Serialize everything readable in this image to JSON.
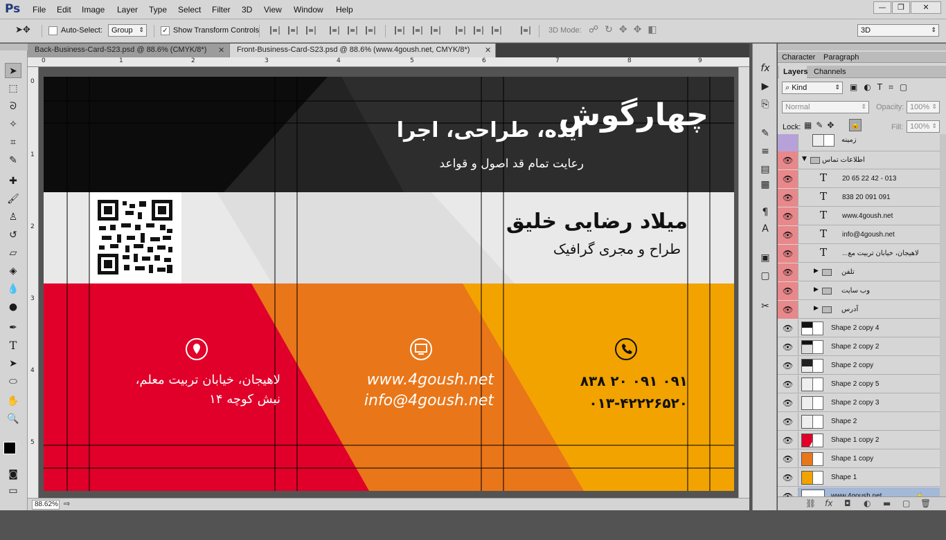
{
  "app": {
    "logo": "Ps"
  },
  "menu": [
    "File",
    "Edit",
    "Image",
    "Layer",
    "Type",
    "Select",
    "Filter",
    "3D",
    "View",
    "Window",
    "Help"
  ],
  "window_controls": {
    "minimize": "—",
    "restore": "❐",
    "close": "✕"
  },
  "options": {
    "auto_select_label": "Auto-Select:",
    "auto_select_value": "Group",
    "show_transform_label": "Show Transform Controls",
    "mode_3d_label": "3D Mode:",
    "workspace": "3D"
  },
  "doc_tabs": [
    {
      "label": "Back-Business-Card-S23.psd @ 88.6% (CMYK/8*)",
      "close": "✕"
    },
    {
      "label": "Front-Business-Card-S23.psd @ 88.6% (www.4goush.net, CMYK/8*)",
      "close": "✕"
    }
  ],
  "ruler_top": [
    "0",
    "1",
    "2",
    "3",
    "4",
    "5",
    "6",
    "7",
    "8",
    "9"
  ],
  "ruler_left": [
    "0",
    "1",
    "2",
    "3",
    "4",
    "5"
  ],
  "card": {
    "logo_text": "چهارگوش",
    "tagline": "ایده، طراحی، اجرا",
    "subtagline": "رعایت تمام قد اصول و قواعد",
    "name": "میلاد رضایی خلیق",
    "job_title": "طراح و مجری گرافیک",
    "address_line1": "لاهیجان، خیابان تربیت معلم،",
    "address_line2": "نبش کوچه ۱۴",
    "web": "www.4goush.net",
    "email": "info@4goush.net",
    "phone1": "۰۹۱ ۰۹۱ ۲۰ ۸۳۸",
    "phone2": "۰۱۳-۴۲۲۲۶۵۲۰",
    "colors": {
      "dark": "#232323",
      "light": "#e9e9e9",
      "red": "#e0002a",
      "orange": "#e97619",
      "yellow": "#f2a300"
    }
  },
  "status": {
    "zoom": "88.62%"
  },
  "panel": {
    "top_tabs": [
      "Character",
      "Paragraph"
    ],
    "tabs": [
      "Layers",
      "Channels"
    ],
    "kind_label": "Kind",
    "blend_mode": "Normal",
    "opacity_label": "Opacity:",
    "opacity": "100%",
    "lock_label": "Lock:",
    "fill_label": "Fill:",
    "fill": "100%",
    "layers": [
      {
        "name": "زمینه",
        "type": "shape",
        "color": "violet",
        "indent": 0,
        "partial": true
      },
      {
        "name": "اطلاعات تماس",
        "type": "group",
        "color": "red",
        "indent": 0,
        "open": true
      },
      {
        "name": "20 65 22 42 - 013",
        "type": "text",
        "color": "red",
        "indent": 1
      },
      {
        "name": "838 20 091 091",
        "type": "text",
        "color": "red",
        "indent": 1
      },
      {
        "name": "www.4goush.net",
        "type": "text",
        "color": "red",
        "indent": 1
      },
      {
        "name": "info@4goush.net",
        "type": "text",
        "color": "red",
        "indent": 1
      },
      {
        "name": "لاهیجان، خیابان تربیت مع...",
        "type": "text",
        "color": "red",
        "indent": 1
      },
      {
        "name": "تلفن",
        "type": "group",
        "color": "red",
        "indent": 1
      },
      {
        "name": "وب سایت",
        "type": "group",
        "color": "red",
        "indent": 1
      },
      {
        "name": "آدرس",
        "type": "group",
        "color": "red",
        "indent": 1
      },
      {
        "name": "Shape 2 copy 4",
        "type": "shape",
        "color": "none",
        "thumb": "blackwhite"
      },
      {
        "name": "Shape 2 copy 2",
        "type": "shape",
        "color": "none",
        "thumb": "black"
      },
      {
        "name": "Shape 2 copy",
        "type": "shape",
        "color": "none",
        "thumb": "blackwhite2"
      },
      {
        "name": "Shape 2 copy 5",
        "type": "shape",
        "color": "none",
        "thumb": "checker"
      },
      {
        "name": "Shape 2 copy 3",
        "type": "shape",
        "color": "none",
        "thumb": "checker"
      },
      {
        "name": "Shape 2",
        "type": "shape",
        "color": "none",
        "thumb": "checker"
      },
      {
        "name": "Shape 1 copy 2",
        "type": "shape",
        "color": "none",
        "thumb": "red"
      },
      {
        "name": "Shape 1 copy",
        "type": "shape",
        "color": "none",
        "thumb": "orange"
      },
      {
        "name": "Shape 1",
        "type": "shape",
        "color": "none",
        "thumb": "yellow"
      },
      {
        "name": "www.4goush.net",
        "type": "bg",
        "color": "none",
        "selected": true,
        "thumb": "white"
      }
    ]
  }
}
